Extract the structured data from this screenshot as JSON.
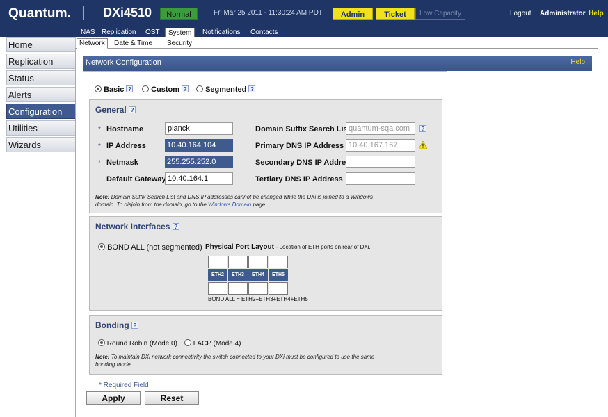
{
  "header": {
    "logo": "Quantum.",
    "model": "DXi4510",
    "status": "Normal",
    "datetime": "Fri Mar 25 2011 - 11:30:24 AM PDT",
    "admin": "Admin",
    "ticket": "Ticket",
    "low_capacity": "Low Capacity",
    "logout": "Logout",
    "user": "Administrator",
    "help": "Help"
  },
  "topnav": [
    "NAS",
    "Replication",
    "OST",
    "System",
    "Notifications",
    "Contacts"
  ],
  "sidebar": [
    "Home",
    "Replication",
    "Status",
    "Alerts",
    "Configuration",
    "Utilities",
    "Wizards"
  ],
  "subnav": [
    "Network",
    "Date & Time",
    "Security"
  ],
  "bar": {
    "title": "Network Configuration",
    "help": "Help"
  },
  "modes": {
    "basic": "Basic",
    "custom": "Custom",
    "segmented": "Segmented",
    "q": "?"
  },
  "general": {
    "title": "General",
    "asterisk": "*",
    "hostname_label": "Hostname",
    "hostname": "planck",
    "ip_label": "IP Address",
    "ip": "10.40.164.104",
    "netmask_label": "Netmask",
    "netmask": "255.255.252.0",
    "gateway_label": "Default Gateway",
    "gateway": "10.40.164.1",
    "domain_label": "Domain Suffix Search List",
    "domain": "quantum-sqa.com",
    "pdns_label": "Primary DNS IP Address",
    "pdns": "10.40.167.167",
    "sdns_label": "Secondary DNS IP Address",
    "sdns": "",
    "tdns_label": "Tertiary DNS IP Address",
    "tdns": "",
    "note_prefix": "Note:",
    "note_text": "Domain Suffix Search List and DNS IP addresses cannot be changed while the DXi is joined to a Windows domain. To disjoin from the domain, go to the",
    "note_link": "Windows Domain",
    "note_suffix": "page."
  },
  "interfaces": {
    "title": "Network Interfaces",
    "bond_label": "BOND ALL (not segmented)",
    "layout_title": "Physical Port Layout",
    "layout_desc": "- Location of ETH ports on rear of DXi.",
    "ports": [
      "ETH2",
      "ETH3",
      "ETH4",
      "ETH5"
    ],
    "bond_formula": "BOND ALL = ETH2+ETH3+ETH4+ETH5"
  },
  "bonding": {
    "title": "Bonding",
    "rr": "Round Robin (Mode 0)",
    "lacp": "LACP (Mode 4)",
    "note_prefix": "Note:",
    "note_text": "To maintain DXi network connectivity the switch connected to your DXi must be configured to use the same bonding mode."
  },
  "footer": {
    "required": "* Required Field",
    "apply": "Apply",
    "reset": "Reset"
  }
}
